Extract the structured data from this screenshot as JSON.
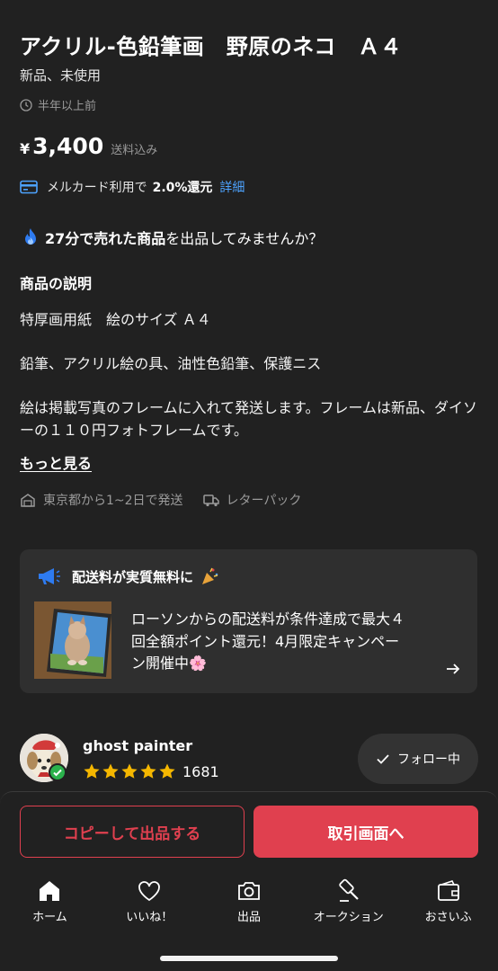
{
  "item": {
    "title": "アクリル-色鉛筆画　野原のネコ　Ａ４",
    "condition": "新品、未使用",
    "posted": "半年以上前",
    "price_symbol": "¥",
    "price": "3,400",
    "shipping_note": "送料込み"
  },
  "mercard": {
    "text_before": "メルカード利用で",
    "rate": "2.0%還元",
    "link": "詳細"
  },
  "promo": {
    "bold": "27分で売れた商品",
    "rest": "を出品してみませんか？"
  },
  "description": {
    "heading": "商品の説明",
    "body": "特厚画用紙　絵のサイズ Ａ４\n\n鉛筆、アクリル絵の具、油性色鉛筆、保護ニス\n\n絵は掲載写真のフレームに入れて発送します。フレームは新品、ダイソーの１１０円フォトフレームです。",
    "more": "もっと見る"
  },
  "shipping": {
    "origin": "東京都から1~2日で発送",
    "method": "レターパック"
  },
  "campaign": {
    "title": "配送料が実質無料に",
    "text": "ローソンからの配送料が条件達成で最大４回全額ポイント還元！4月限定キャンペーン開催中🌸"
  },
  "seller": {
    "name": "ghost painter",
    "rating": 5,
    "review_count": "1681",
    "follow_label": "フォロー中"
  },
  "actions": {
    "copy_label": "コピーして出品する",
    "trade_label": "取引画面へ"
  },
  "tabs": [
    {
      "label": "ホーム",
      "icon": "home-icon"
    },
    {
      "label": "いいね！",
      "icon": "heart-icon"
    },
    {
      "label": "出品",
      "icon": "camera-icon"
    },
    {
      "label": "オークション",
      "icon": "gavel-icon"
    },
    {
      "label": "おさいふ",
      "icon": "wallet-icon"
    }
  ],
  "colors": {
    "background": "#212121",
    "accent": "#e0404f",
    "link": "#4da3ff",
    "star": "#f5b700"
  }
}
